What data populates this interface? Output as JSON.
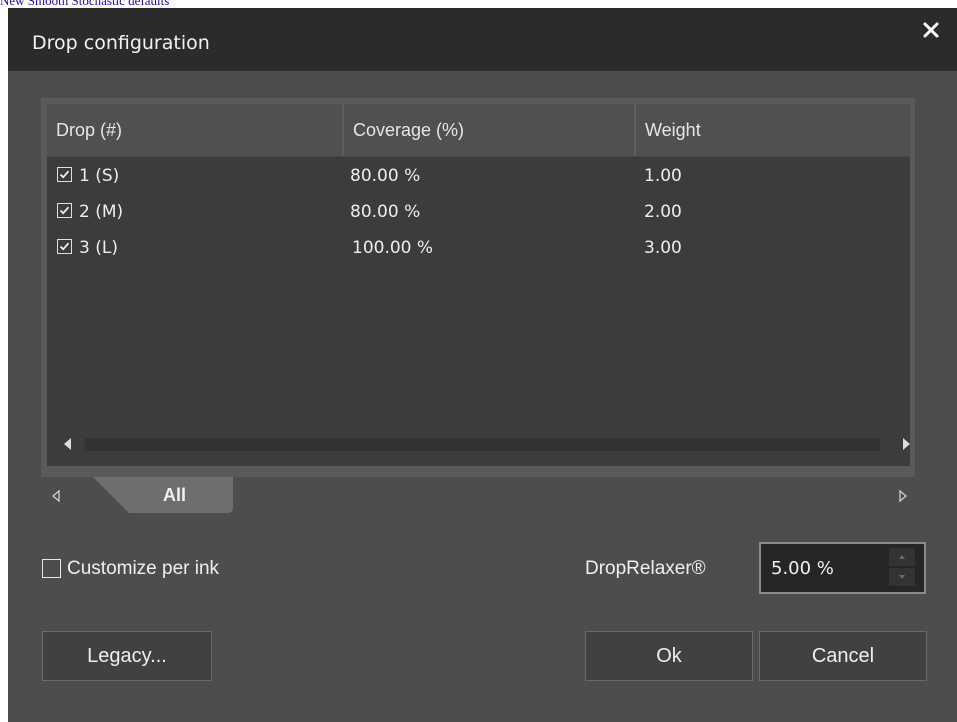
{
  "page": {
    "caption": "New Smooth Stochastic defaults"
  },
  "dialog": {
    "title": "Drop configuration",
    "close_icon": "close-icon"
  },
  "table": {
    "columns": [
      "Drop (#)",
      "Coverage (%)",
      "Weight"
    ],
    "rows": [
      {
        "checked": true,
        "drop": "1 (S)",
        "coverage": "80.00 %",
        "weight": "1.00"
      },
      {
        "checked": true,
        "drop": "2 (M)",
        "coverage": "80.00 %",
        "weight": "2.00"
      },
      {
        "checked": true,
        "drop": "3 (L)",
        "coverage": "100.00 %",
        "weight": "3.00"
      }
    ]
  },
  "tabs": {
    "items": [
      "All"
    ],
    "active": "All"
  },
  "options": {
    "customize_label": "Customize per ink",
    "customize_checked": false,
    "relaxer_label": "DropRelaxer®",
    "relaxer_value": "5.00 %"
  },
  "buttons": {
    "legacy": "Legacy...",
    "ok": "Ok",
    "cancel": "Cancel"
  },
  "colors": {
    "dialog_bg": "#4d4d4d",
    "titlebar_bg": "#2b2b2b",
    "grid_bg": "#3c3c3c",
    "header_bg": "#505050"
  }
}
